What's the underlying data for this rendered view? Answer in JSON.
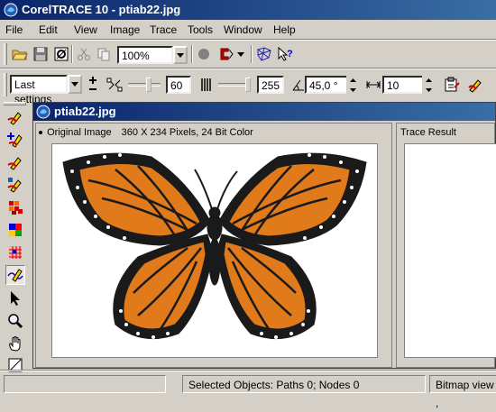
{
  "app": {
    "title": "CorelTRACE 10 - ptiab22.jpg"
  },
  "menu": [
    {
      "label": "File"
    },
    {
      "label": "Edit"
    },
    {
      "label": "View"
    },
    {
      "label": "Image"
    },
    {
      "label": "Trace"
    },
    {
      "label": "Tools"
    },
    {
      "label": "Window"
    },
    {
      "label": "Help"
    }
  ],
  "toolbar1": {
    "zoom_value": "100%",
    "icons": [
      "open-folder-icon",
      "save-icon",
      "scan-icon",
      "cut-icon",
      "copy-icon",
      "dropdown-icon",
      "circle-icon",
      "trace-magnet-icon",
      "dropdown-icon",
      "trace-mesh-icon",
      "help-cursor-icon"
    ]
  },
  "toolbar2": {
    "preset_value": "Last settings",
    "node_reduction_value": "60",
    "color_count_value": "255",
    "angle_value": "45,0 °",
    "width_value": "10"
  },
  "left_tools": {
    "icons": [
      "pen-trace-icon",
      "pen-plus-icon",
      "pen-edit-icon",
      "pen-color-icon",
      "mosaic-icon",
      "color-block-icon",
      "grid-pattern-icon",
      "wave-trace-icon",
      "pointer-icon",
      "zoom-icon",
      "hand-pan-icon",
      "eraser-line-icon"
    ]
  },
  "document": {
    "title": "ptiab22.jpg",
    "original_label": "Original Image",
    "original_info": "360 X 234 Pixels, 24 Bit Color",
    "result_label": "Trace Result"
  },
  "status": {
    "selection": "Selected Objects: Paths 0; Nodes 0",
    "view": "Bitmap view ,"
  },
  "colors": {
    "title_start": "#0a246a",
    "title_end": "#3a6ea5",
    "chrome": "#d4d0c8",
    "butterfly_orange": "#e07a1a",
    "butterfly_black": "#1a1a1a"
  }
}
